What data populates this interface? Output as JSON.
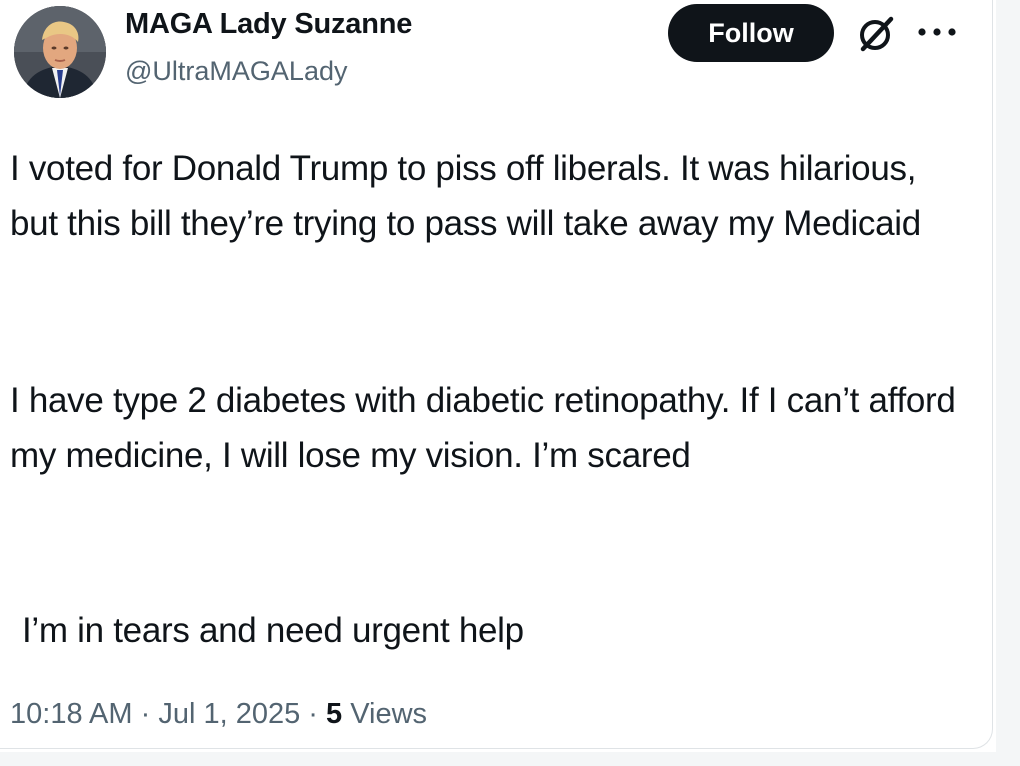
{
  "post": {
    "author": {
      "display_name": "MAGA Lady Suzanne",
      "handle": "@UltraMAGALady",
      "avatar_icon": "profile-photo"
    },
    "actions": {
      "follow_label": "Follow",
      "grok_icon": "grok-icon",
      "more_icon": "more-options-icon"
    },
    "text": {
      "paragraph_1": "I voted for Donald Trump to piss off liberals. It was hilarious, but this bill they’re trying to pass will take away my Medicaid",
      "paragraph_2": "I have type 2 diabetes with diabetic retinopathy. If I can’t afford my medicine, I will lose my vision. I’m scared",
      "paragraph_3": "I’m in tears and need urgent help"
    },
    "meta": {
      "time": "10:18 AM",
      "separator": "·",
      "date": "Jul 1, 2025",
      "views_count": "5",
      "views_label": "Views"
    }
  },
  "colors": {
    "text_primary": "#0f1419",
    "text_secondary": "#536471",
    "button_bg": "#0f1419",
    "button_text": "#ffffff"
  }
}
